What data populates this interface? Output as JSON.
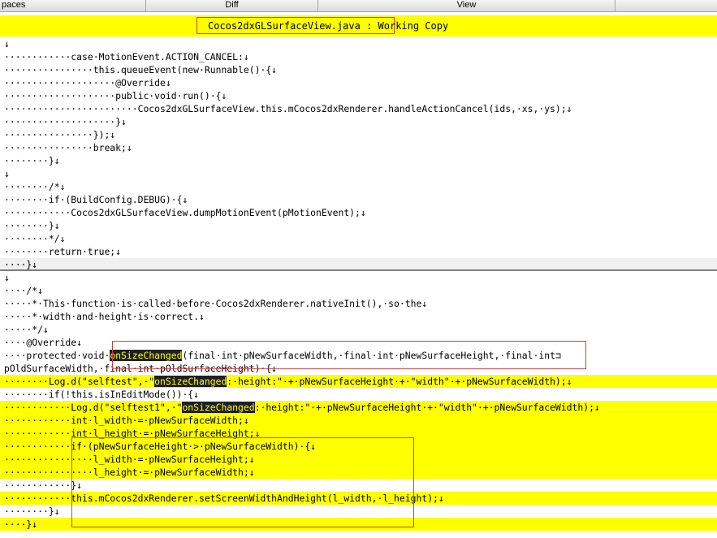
{
  "tabs": [
    "paces",
    "Diff",
    "View",
    ""
  ],
  "file_title": "Cocos2dxGLSurfaceView.java : Working Copy",
  "lines": [
    {
      "text": "↓",
      "hl": false
    },
    {
      "text": "············case·MotionEvent.ACTION_CANCEL:↓",
      "hl": false
    },
    {
      "text": "················this.queueEvent(new·Runnable()·{↓",
      "hl": false
    },
    {
      "text": "····················@Override↓",
      "hl": false
    },
    {
      "text": "····················public·void·run()·{↓",
      "hl": false
    },
    {
      "text": "························Cocos2dxGLSurfaceView.this.mCocos2dxRenderer.handleActionCancel(ids,·xs,·ys);↓",
      "hl": false
    },
    {
      "text": "····················}↓",
      "hl": false
    },
    {
      "text": "················});↓",
      "hl": false
    },
    {
      "text": "················break;↓",
      "hl": false
    },
    {
      "text": "········}↓",
      "hl": false
    },
    {
      "text": "↓",
      "hl": false
    },
    {
      "text": "········/*↓",
      "hl": false
    },
    {
      "text": "········if·(BuildConfig.DEBUG)·{↓",
      "hl": false
    },
    {
      "text": "············Cocos2dxGLSurfaceView.dumpMotionEvent(pMotionEvent);↓",
      "hl": false
    },
    {
      "text": "········}↓",
      "hl": false
    },
    {
      "text": "········*/↓",
      "hl": false
    },
    {
      "text": "········return·true;↓",
      "hl": false
    },
    {
      "text": "····}↓",
      "hl": false,
      "sep": true
    },
    {
      "text": "↓",
      "hl": false
    },
    {
      "text": "····/*↓",
      "hl": false
    },
    {
      "text": "·····*·This·function·is·called·before·Cocos2dxRenderer.nativeInit(),·so·the↓",
      "hl": false
    },
    {
      "text": "·····*·width·and·height·is·correct.↓",
      "hl": false
    },
    {
      "text": "·····*/↓",
      "hl": false
    },
    {
      "text": "····@Override↓",
      "hl": false
    },
    {
      "pre": "····protected·void·",
      "mark": "onSizeChanged",
      "post": "(final·int·pNewSurfaceWidth,·final·int·pNewSurfaceHeight,·final·int⊐",
      "hl": false
    },
    {
      "text": "pOldSurfaceWidth,·final·int·pOldSurfaceHeight)·{↓",
      "hl": false
    },
    {
      "pre": "········Log.d(\"selftest\",·\"",
      "mark": "onSizeChanged",
      "post": ":·height:\"·+·pNewSurfaceHeight·+·\"width\"·+·pNewSurfaceWidth);↓",
      "hl": true
    },
    {
      "text": "········if(!this.isInEditMode())·{↓",
      "hl": false
    },
    {
      "pre": "············Log.d(\"selftest1\",·\"",
      "mark": "onSizeChanged",
      "post": ":·height:\"·+·pNewSurfaceHeight·+·\"width\"·+·pNewSurfaceWidth);↓",
      "hl": true
    },
    {
      "text": "············int·l_width·=·pNewSurfaceWidth;↓",
      "hl": true
    },
    {
      "text": "············int·l_height·=·pNewSurfaceHeight;↓",
      "hl": true
    },
    {
      "text": "············if·(pNewSurfaceHeight·>·pNewSurfaceWidth)·{↓",
      "hl": true
    },
    {
      "text": "················l_width·=·pNewSurfaceHeight;↓",
      "hl": true
    },
    {
      "text": "················l_height·=·pNewSurfaceWidth;↓",
      "hl": true
    },
    {
      "text": "············}↓",
      "hl": false
    },
    {
      "text": "············this.mCocos2dxRenderer.setScreenWidthAndHeight(l_width,·l_height);↓",
      "hl": true
    },
    {
      "text": "········}↓",
      "hl": false
    },
    {
      "text": "····}↓",
      "hl": true
    }
  ]
}
